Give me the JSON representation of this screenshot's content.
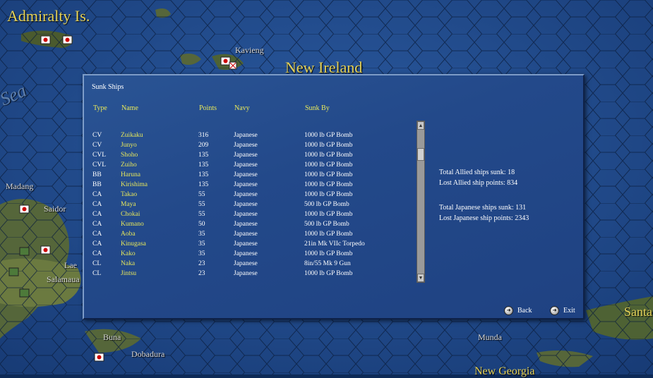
{
  "map": {
    "labels": {
      "admiralty": "Admiralty Is.",
      "kavieng": "Kavieng",
      "new_ireland": "New Ireland",
      "sea": "Sea",
      "madang": "Madang",
      "saidor": "Saidor",
      "lae": "Lae",
      "salamaua": "Salamaua",
      "buna": "Buna",
      "dobadura": "Dobadura",
      "munda": "Munda",
      "santa": "Santa",
      "new_georgia": "New Georgia"
    }
  },
  "panel": {
    "title": "Sunk Ships",
    "headers": {
      "type": "Type",
      "name": "Name",
      "points": "Points",
      "navy": "Navy",
      "sunk_by": "Sunk By"
    },
    "rows": [
      {
        "type": "CV",
        "name": "Zuikaku",
        "points": "316",
        "navy": "Japanese",
        "sunk_by": "1000 lb GP Bomb"
      },
      {
        "type": "CV",
        "name": "Junyo",
        "points": "209",
        "navy": "Japanese",
        "sunk_by": "1000 lb GP Bomb"
      },
      {
        "type": "CVL",
        "name": "Shoho",
        "points": "135",
        "navy": "Japanese",
        "sunk_by": "1000 lb GP Bomb"
      },
      {
        "type": "CVL",
        "name": "Zuiho",
        "points": "135",
        "navy": "Japanese",
        "sunk_by": "1000 lb GP Bomb"
      },
      {
        "type": "BB",
        "name": "Haruna",
        "points": "135",
        "navy": "Japanese",
        "sunk_by": "1000 lb GP Bomb"
      },
      {
        "type": "BB",
        "name": "Kirishima",
        "points": "135",
        "navy": "Japanese",
        "sunk_by": "1000 lb GP Bomb"
      },
      {
        "type": "CA",
        "name": "Takao",
        "points": "55",
        "navy": "Japanese",
        "sunk_by": "1000 lb GP Bomb"
      },
      {
        "type": "CA",
        "name": "Maya",
        "points": "55",
        "navy": "Japanese",
        "sunk_by": "500 lb GP Bomb"
      },
      {
        "type": "CA",
        "name": "Chokai",
        "points": "55",
        "navy": "Japanese",
        "sunk_by": "1000 lb GP Bomb"
      },
      {
        "type": "CA",
        "name": "Kumano",
        "points": "50",
        "navy": "Japanese",
        "sunk_by": "500 lb GP Bomb"
      },
      {
        "type": "CA",
        "name": "Aoba",
        "points": "35",
        "navy": "Japanese",
        "sunk_by": "1000 lb GP Bomb"
      },
      {
        "type": "CA",
        "name": "Kinugasa",
        "points": "35",
        "navy": "Japanese",
        "sunk_by": "21in Mk VIIc Torpedo"
      },
      {
        "type": "CA",
        "name": "Kako",
        "points": "35",
        "navy": "Japanese",
        "sunk_by": "1000 lb GP Bomb"
      },
      {
        "type": "CL",
        "name": "Naka",
        "points": "23",
        "navy": "Japanese",
        "sunk_by": "8in/55 Mk 9 Gun"
      },
      {
        "type": "CL",
        "name": "Jintsu",
        "points": "23",
        "navy": "Japanese",
        "sunk_by": "1000 lb GP Bomb"
      }
    ],
    "stats": {
      "allied_sunk": "Total Allied ships sunk: 18",
      "allied_points": "Lost Allied ship points: 834",
      "japanese_sunk": "Total Japanese ships sunk: 131",
      "japanese_points": "Lost Japanese ship points: 2343"
    },
    "buttons": {
      "back": "Back",
      "exit": "Exit"
    },
    "icons": {
      "back": "back-arrow-icon",
      "exit": "exit-arrow-icon",
      "scroll_up": "scroll-up-arrow-icon",
      "scroll_down": "scroll-down-arrow-icon"
    }
  }
}
